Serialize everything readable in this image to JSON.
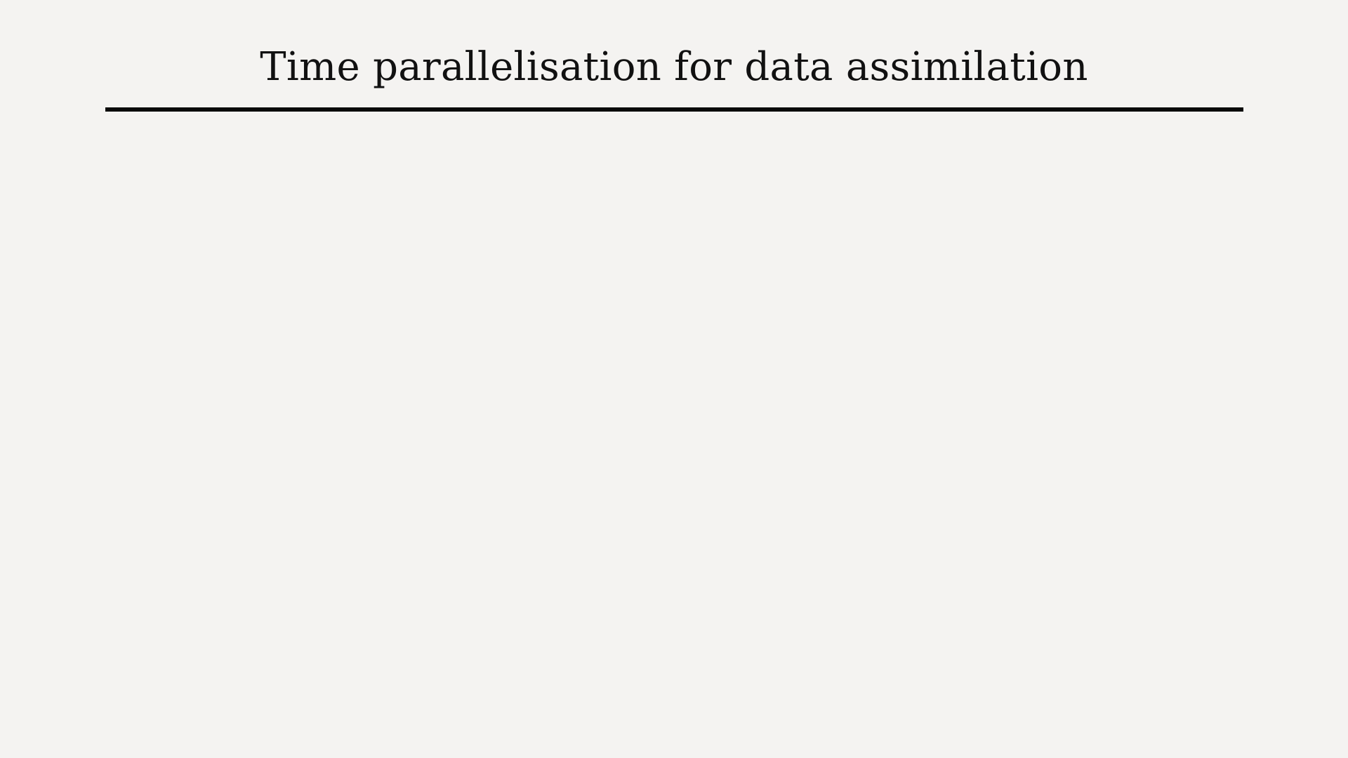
{
  "slide": {
    "title": "Time parallelisation for data assimilation"
  },
  "colors": {
    "background": "#f4f3f1",
    "title_text": "#111111",
    "rule": "#0a0a0a"
  }
}
